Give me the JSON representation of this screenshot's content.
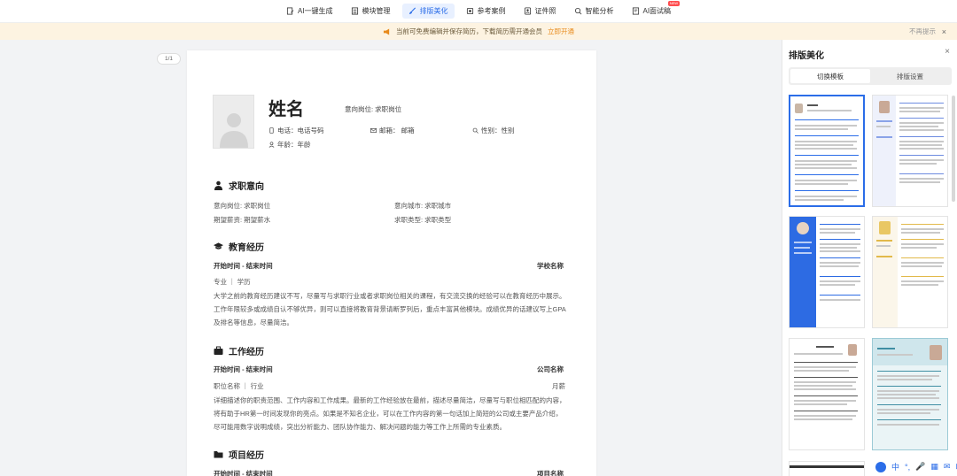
{
  "toolbar": {
    "items": [
      {
        "label": "AI一键生成",
        "icon": "document-edit-icon"
      },
      {
        "label": "模块管理",
        "icon": "list-icon"
      },
      {
        "label": "排版美化",
        "icon": "brush-icon",
        "active": true
      },
      {
        "label": "参考案例",
        "icon": "book-icon"
      },
      {
        "label": "证件照",
        "icon": "id-photo-icon"
      },
      {
        "label": "智能分析",
        "icon": "analysis-icon"
      },
      {
        "label": "AI面试稿",
        "icon": "interview-icon",
        "badge": "NEW"
      }
    ]
  },
  "notice": {
    "text": "当前可免费编辑并保存简历，下载简历需开通会员",
    "link": "立即开通",
    "dismiss": "不再提示",
    "close": "×"
  },
  "pager": "1/1",
  "resume": {
    "name": "姓名",
    "intent_top": "意向岗位: 求职岗位",
    "phone": "电话：电话号码",
    "email": "邮箱：  邮箱",
    "gender": "性别：性别",
    "age": "年龄：年龄",
    "job_intent": {
      "title": "求职意向",
      "position": "意向岗位: 求职岗位",
      "city": "意向城市: 求职城市",
      "salary": "期望薪资: 期望薪水",
      "type": "求职类型: 求职类型"
    },
    "education": {
      "title": "教育经历",
      "time": "开始时间  -  结束时间",
      "school": "学校名称",
      "major": "专业  ｜ 学历",
      "desc": "大学之前的教育经历建议不写，尽量写与求职行业或者求职岗位相关的课程，有交流交换的经验可以在教育经历中展示。工作年限较多或成绩自认不够优异，则可以直接将教育背景请断罗列后，重点丰富其他模块。成绩优异的话建议写上GPA及排名等信息，尽量简洁。"
    },
    "work": {
      "title": "工作经历",
      "time": "开始时间  -  结束时间",
      "company": "公司名称",
      "job": "职位名称  ｜ 行业",
      "salary": "月薪",
      "desc": "详细描述你的职责范围、工作内容和工作成果。最新的工作经验放在最前，描述尽量简洁，尽量写与职位相匹配的内容，将有助于HR第一时间发现你的亮点。如果是不知名企业，可以在工作内容的第一句话加上简短的公司或主要产品介绍，尽可能用数字说明成绩，突出分析能力、团队协作能力、解决问题的能力等工作上所需的专业素质。"
    },
    "project": {
      "title": "项目经历",
      "time": "开始时间  -  结束时间",
      "name": "项目名称"
    }
  },
  "panel": {
    "title": "排版美化",
    "close": "×",
    "tab_template": "切换模板",
    "tab_settings": "排版设置"
  },
  "bottom_tools": [
    "中",
    "°,",
    "🎤",
    "▦",
    "✉",
    "⊞"
  ],
  "colors": {
    "accent": "#2b6de8",
    "notice_bg": "#fdf3e1",
    "notice_link": "#e88a1a"
  }
}
